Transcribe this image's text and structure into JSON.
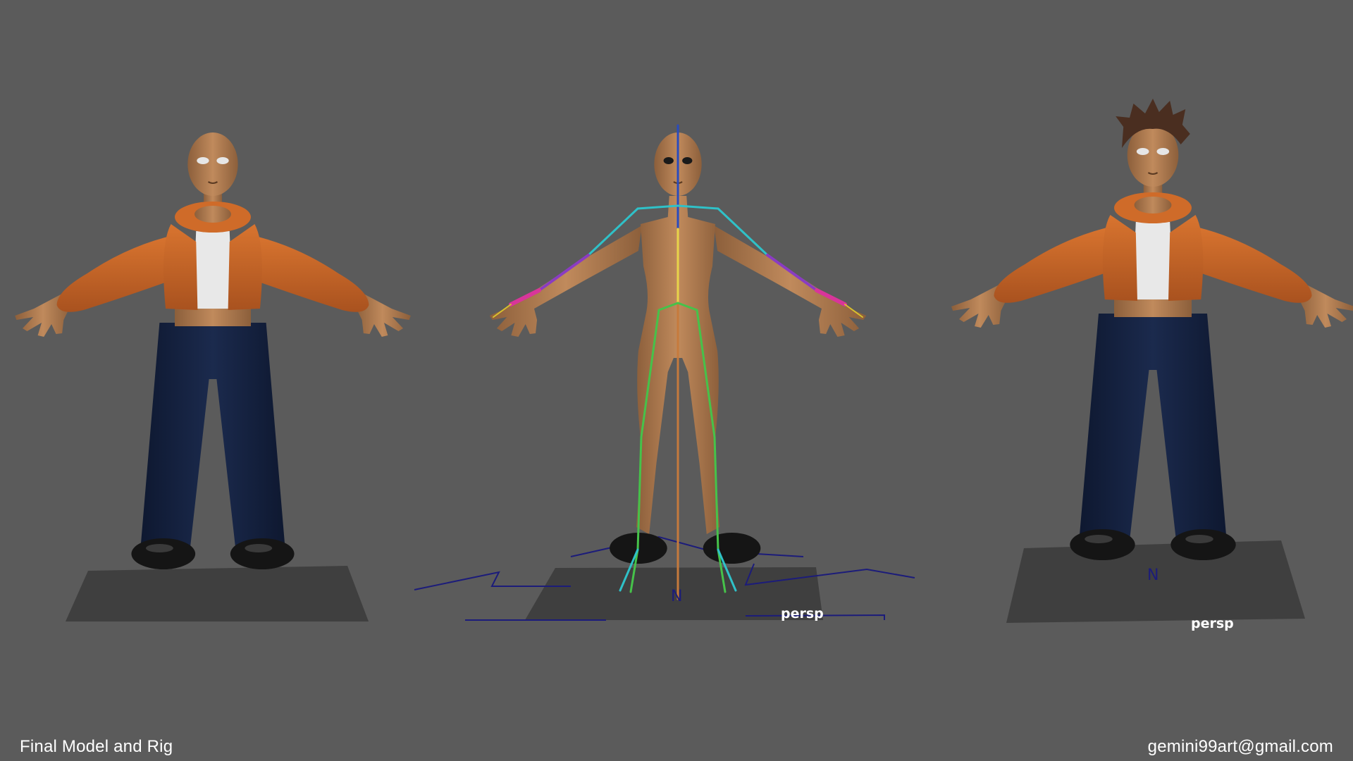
{
  "viewports": [
    {
      "name": "final-model",
      "view_label": "",
      "show_rig": false,
      "show_hair": false
    },
    {
      "name": "rig",
      "view_label": "persp",
      "compass_label": "N",
      "show_rig": true,
      "show_hair": false
    },
    {
      "name": "final-model-hair",
      "view_label": "persp",
      "compass_label": "N",
      "show_rig": false,
      "show_hair": true
    }
  ],
  "footer": {
    "left": "Final Model and Rig",
    "right": "gemini99art@gmail.com"
  },
  "colors": {
    "background": "#5b5b5b",
    "skin": "#b07a4f",
    "jacket": "#c8662a",
    "pants": "#16223f",
    "top": "#e8e8e8",
    "shoes": "#141414",
    "ground_plane": "#3f3f3f",
    "grid_lines": "#1c1c7a"
  }
}
